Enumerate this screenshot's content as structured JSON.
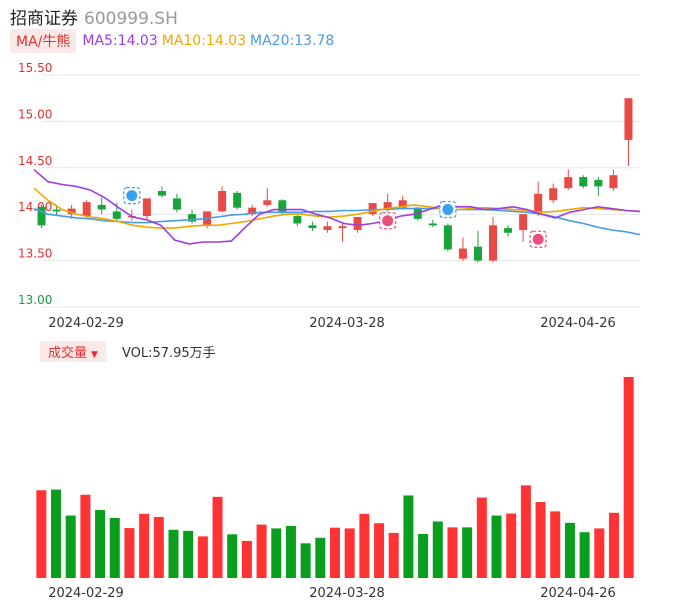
{
  "header": {
    "name": "招商证券",
    "code": "600999.SH"
  },
  "ma_legend": {
    "button": "MA/牛熊",
    "items": [
      {
        "label": "MA5:14.03",
        "color": "#9c3ce8"
      },
      {
        "label": "MA10:14.03",
        "color": "#f0a800"
      },
      {
        "label": "MA20:13.78",
        "color": "#4a9be8"
      }
    ]
  },
  "volume_legend": {
    "button": "成交量",
    "text": "VOL:57.95万手"
  },
  "colors": {
    "up": "#e84a45",
    "down": "#18a33b",
    "grid": "#e6e6e6"
  },
  "chart_data": [
    {
      "type": "candlestick",
      "ylim": [
        13.0,
        15.5
      ],
      "yticks": [
        "15.50",
        "15.00",
        "14.50",
        "14.00",
        "13.50",
        "13.00"
      ],
      "x_labels": [
        "2024-02-29",
        "2024-03-28",
        "2024-04-26"
      ],
      "ohlc": [
        [
          14.08,
          14.1,
          13.85,
          13.88
        ],
        [
          14.05,
          14.1,
          13.98,
          14.03
        ],
        [
          14.0,
          14.1,
          13.95,
          14.06
        ],
        [
          13.98,
          14.15,
          13.95,
          14.13
        ],
        [
          14.1,
          14.18,
          14.0,
          14.05
        ],
        [
          14.03,
          14.12,
          13.92,
          13.95
        ],
        [
          13.97,
          14.05,
          13.93,
          13.98
        ],
        [
          13.98,
          14.17,
          13.95,
          14.17
        ],
        [
          14.25,
          14.3,
          14.18,
          14.2
        ],
        [
          14.17,
          14.22,
          14.02,
          14.05
        ],
        [
          14.0,
          14.05,
          13.9,
          13.92
        ],
        [
          13.88,
          14.03,
          13.85,
          14.03
        ],
        [
          14.03,
          14.3,
          14.02,
          14.25
        ],
        [
          14.23,
          14.25,
          14.05,
          14.07
        ],
        [
          14.0,
          14.1,
          13.98,
          14.07
        ],
        [
          14.1,
          14.28,
          14.08,
          14.15
        ],
        [
          14.15,
          14.16,
          14.0,
          14.03
        ],
        [
          13.98,
          14.0,
          13.87,
          13.9
        ],
        [
          13.88,
          13.92,
          13.82,
          13.85
        ],
        [
          13.83,
          13.92,
          13.8,
          13.87
        ],
        [
          13.85,
          13.9,
          13.7,
          13.87
        ],
        [
          13.83,
          13.95,
          13.8,
          13.97
        ],
        [
          14.0,
          14.12,
          13.98,
          14.12
        ],
        [
          14.05,
          14.22,
          14.03,
          14.13
        ],
        [
          14.07,
          14.2,
          14.05,
          14.15
        ],
        [
          14.07,
          14.08,
          13.93,
          13.95
        ],
        [
          13.9,
          13.94,
          13.86,
          13.88
        ],
        [
          13.88,
          13.9,
          13.6,
          13.62
        ],
        [
          13.52,
          13.75,
          13.5,
          13.63
        ],
        [
          13.65,
          13.82,
          13.48,
          13.5
        ],
        [
          13.5,
          13.97,
          13.48,
          13.88
        ],
        [
          13.85,
          13.88,
          13.76,
          13.8
        ],
        [
          13.83,
          14.0,
          13.7,
          14.0
        ],
        [
          14.03,
          14.35,
          13.98,
          14.22
        ],
        [
          14.15,
          14.33,
          14.12,
          14.28
        ],
        [
          14.28,
          14.48,
          14.26,
          14.4
        ],
        [
          14.4,
          14.42,
          14.28,
          14.3
        ],
        [
          14.37,
          14.4,
          14.2,
          14.3
        ],
        [
          14.28,
          14.48,
          14.25,
          14.42
        ],
        [
          14.8,
          15.25,
          14.52,
          15.25
        ]
      ],
      "ma5": [
        14.48,
        14.35,
        14.32,
        14.3,
        14.26,
        14.18,
        14.07,
        13.97,
        13.94,
        13.88,
        13.72,
        13.68,
        13.7,
        13.7,
        13.71,
        13.86,
        14.0,
        14.05,
        14.05,
        14.05,
        14.0,
        13.96,
        13.9,
        13.88,
        13.9,
        13.93,
        13.98,
        14.0,
        14.05,
        14.1,
        14.08,
        14.08,
        14.05,
        14.06,
        14.08,
        14.05,
        14.0,
        13.96,
        14.02,
        14.05,
        14.08,
        14.06,
        14.04,
        14.03
      ],
      "ma10": [
        14.28,
        14.15,
        14.05,
        14.0,
        13.97,
        13.95,
        13.92,
        13.88,
        13.86,
        13.85,
        13.85,
        13.87,
        13.88,
        13.88,
        13.9,
        13.92,
        13.95,
        13.98,
        14.0,
        14.0,
        13.98,
        13.97,
        13.98,
        14.0,
        14.03,
        14.06,
        14.08,
        14.1,
        14.08,
        14.06,
        14.05,
        14.06,
        14.07,
        14.06,
        14.05,
        14.04,
        14.02,
        14.03,
        14.05,
        14.07,
        14.06,
        14.05,
        14.04,
        14.03
      ],
      "ma20": [
        14.06,
        14.0,
        13.98,
        13.96,
        13.95,
        13.93,
        13.92,
        13.91,
        13.91,
        13.92,
        13.93,
        13.94,
        13.95,
        13.97,
        13.99,
        14.0,
        14.02,
        14.02,
        14.02,
        14.02,
        14.03,
        14.03,
        14.04,
        14.04,
        14.05,
        14.05,
        14.06,
        14.06,
        14.06,
        14.06,
        14.05,
        14.05,
        14.05,
        14.04,
        14.03,
        14.02,
        14.0,
        13.97,
        13.93,
        13.9,
        13.86,
        13.83,
        13.81,
        13.78
      ]
    },
    {
      "type": "bar",
      "label": "成交量",
      "unit": "万手",
      "x_labels": [
        "2024-02-29",
        "2024-03-28",
        "2024-04-26"
      ],
      "values": [
        25.3,
        25.5,
        18.0,
        24.0,
        19.6,
        17.3,
        14.4,
        18.5,
        17.6,
        13.9,
        13.6,
        12.0,
        23.4,
        12.6,
        10.7,
        15.4,
        14.3,
        15.0,
        10.0,
        11.6,
        14.5,
        14.3,
        18.5,
        15.8,
        13.0,
        23.8,
        12.7,
        16.3,
        14.6,
        14.6,
        23.2,
        18.0,
        18.6,
        26.7,
        21.9,
        19.2,
        15.9,
        13.2,
        14.3,
        18.8,
        57.95
      ],
      "direction": [
        "up",
        "down",
        "down",
        "up",
        "down",
        "down",
        "up",
        "up",
        "up",
        "down",
        "down",
        "up",
        "up",
        "down",
        "up",
        "up",
        "down",
        "down",
        "down",
        "down",
        "up",
        "up",
        "up",
        "up",
        "up",
        "down",
        "down",
        "down",
        "up",
        "down",
        "up",
        "down",
        "up",
        "up",
        "up",
        "up",
        "down",
        "down",
        "up",
        "up",
        "up"
      ]
    }
  ]
}
